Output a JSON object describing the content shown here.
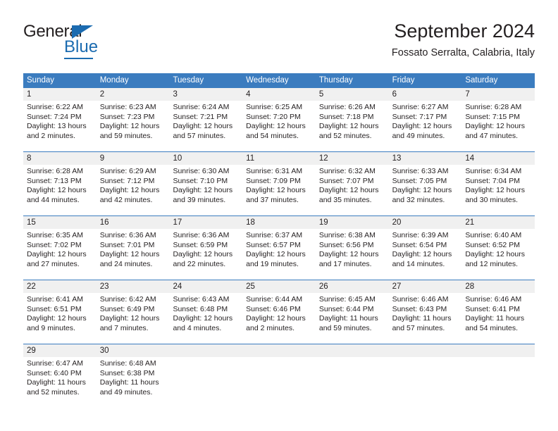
{
  "brand": {
    "name_part1": "General",
    "name_part2": "Blue",
    "logo_icon": "triangle-flag-icon",
    "accent_color": "#1b6bb0"
  },
  "header": {
    "month_title": "September 2024",
    "location": "Fossato Serralta, Calabria, Italy",
    "header_bg_color": "#3b7cbf",
    "daynumber_bg_color": "#f0f0f0"
  },
  "weekdays": [
    "Sunday",
    "Monday",
    "Tuesday",
    "Wednesday",
    "Thursday",
    "Friday",
    "Saturday"
  ],
  "labels": {
    "sunrise_prefix": "Sunrise:",
    "sunset_prefix": "Sunset:",
    "daylight_prefix": "Daylight:"
  },
  "weeks": [
    {
      "days": [
        {
          "num": "1",
          "sunrise": "Sunrise: 6:22 AM",
          "sunset": "Sunset: 7:24 PM",
          "daylight_1": "Daylight: 13 hours",
          "daylight_2": "and 2 minutes."
        },
        {
          "num": "2",
          "sunrise": "Sunrise: 6:23 AM",
          "sunset": "Sunset: 7:23 PM",
          "daylight_1": "Daylight: 12 hours",
          "daylight_2": "and 59 minutes."
        },
        {
          "num": "3",
          "sunrise": "Sunrise: 6:24 AM",
          "sunset": "Sunset: 7:21 PM",
          "daylight_1": "Daylight: 12 hours",
          "daylight_2": "and 57 minutes."
        },
        {
          "num": "4",
          "sunrise": "Sunrise: 6:25 AM",
          "sunset": "Sunset: 7:20 PM",
          "daylight_1": "Daylight: 12 hours",
          "daylight_2": "and 54 minutes."
        },
        {
          "num": "5",
          "sunrise": "Sunrise: 6:26 AM",
          "sunset": "Sunset: 7:18 PM",
          "daylight_1": "Daylight: 12 hours",
          "daylight_2": "and 52 minutes."
        },
        {
          "num": "6",
          "sunrise": "Sunrise: 6:27 AM",
          "sunset": "Sunset: 7:17 PM",
          "daylight_1": "Daylight: 12 hours",
          "daylight_2": "and 49 minutes."
        },
        {
          "num": "7",
          "sunrise": "Sunrise: 6:28 AM",
          "sunset": "Sunset: 7:15 PM",
          "daylight_1": "Daylight: 12 hours",
          "daylight_2": "and 47 minutes."
        }
      ]
    },
    {
      "days": [
        {
          "num": "8",
          "sunrise": "Sunrise: 6:28 AM",
          "sunset": "Sunset: 7:13 PM",
          "daylight_1": "Daylight: 12 hours",
          "daylight_2": "and 44 minutes."
        },
        {
          "num": "9",
          "sunrise": "Sunrise: 6:29 AM",
          "sunset": "Sunset: 7:12 PM",
          "daylight_1": "Daylight: 12 hours",
          "daylight_2": "and 42 minutes."
        },
        {
          "num": "10",
          "sunrise": "Sunrise: 6:30 AM",
          "sunset": "Sunset: 7:10 PM",
          "daylight_1": "Daylight: 12 hours",
          "daylight_2": "and 39 minutes."
        },
        {
          "num": "11",
          "sunrise": "Sunrise: 6:31 AM",
          "sunset": "Sunset: 7:09 PM",
          "daylight_1": "Daylight: 12 hours",
          "daylight_2": "and 37 minutes."
        },
        {
          "num": "12",
          "sunrise": "Sunrise: 6:32 AM",
          "sunset": "Sunset: 7:07 PM",
          "daylight_1": "Daylight: 12 hours",
          "daylight_2": "and 35 minutes."
        },
        {
          "num": "13",
          "sunrise": "Sunrise: 6:33 AM",
          "sunset": "Sunset: 7:05 PM",
          "daylight_1": "Daylight: 12 hours",
          "daylight_2": "and 32 minutes."
        },
        {
          "num": "14",
          "sunrise": "Sunrise: 6:34 AM",
          "sunset": "Sunset: 7:04 PM",
          "daylight_1": "Daylight: 12 hours",
          "daylight_2": "and 30 minutes."
        }
      ]
    },
    {
      "days": [
        {
          "num": "15",
          "sunrise": "Sunrise: 6:35 AM",
          "sunset": "Sunset: 7:02 PM",
          "daylight_1": "Daylight: 12 hours",
          "daylight_2": "and 27 minutes."
        },
        {
          "num": "16",
          "sunrise": "Sunrise: 6:36 AM",
          "sunset": "Sunset: 7:01 PM",
          "daylight_1": "Daylight: 12 hours",
          "daylight_2": "and 24 minutes."
        },
        {
          "num": "17",
          "sunrise": "Sunrise: 6:36 AM",
          "sunset": "Sunset: 6:59 PM",
          "daylight_1": "Daylight: 12 hours",
          "daylight_2": "and 22 minutes."
        },
        {
          "num": "18",
          "sunrise": "Sunrise: 6:37 AM",
          "sunset": "Sunset: 6:57 PM",
          "daylight_1": "Daylight: 12 hours",
          "daylight_2": "and 19 minutes."
        },
        {
          "num": "19",
          "sunrise": "Sunrise: 6:38 AM",
          "sunset": "Sunset: 6:56 PM",
          "daylight_1": "Daylight: 12 hours",
          "daylight_2": "and 17 minutes."
        },
        {
          "num": "20",
          "sunrise": "Sunrise: 6:39 AM",
          "sunset": "Sunset: 6:54 PM",
          "daylight_1": "Daylight: 12 hours",
          "daylight_2": "and 14 minutes."
        },
        {
          "num": "21",
          "sunrise": "Sunrise: 6:40 AM",
          "sunset": "Sunset: 6:52 PM",
          "daylight_1": "Daylight: 12 hours",
          "daylight_2": "and 12 minutes."
        }
      ]
    },
    {
      "days": [
        {
          "num": "22",
          "sunrise": "Sunrise: 6:41 AM",
          "sunset": "Sunset: 6:51 PM",
          "daylight_1": "Daylight: 12 hours",
          "daylight_2": "and 9 minutes."
        },
        {
          "num": "23",
          "sunrise": "Sunrise: 6:42 AM",
          "sunset": "Sunset: 6:49 PM",
          "daylight_1": "Daylight: 12 hours",
          "daylight_2": "and 7 minutes."
        },
        {
          "num": "24",
          "sunrise": "Sunrise: 6:43 AM",
          "sunset": "Sunset: 6:48 PM",
          "daylight_1": "Daylight: 12 hours",
          "daylight_2": "and 4 minutes."
        },
        {
          "num": "25",
          "sunrise": "Sunrise: 6:44 AM",
          "sunset": "Sunset: 6:46 PM",
          "daylight_1": "Daylight: 12 hours",
          "daylight_2": "and 2 minutes."
        },
        {
          "num": "26",
          "sunrise": "Sunrise: 6:45 AM",
          "sunset": "Sunset: 6:44 PM",
          "daylight_1": "Daylight: 11 hours",
          "daylight_2": "and 59 minutes."
        },
        {
          "num": "27",
          "sunrise": "Sunrise: 6:46 AM",
          "sunset": "Sunset: 6:43 PM",
          "daylight_1": "Daylight: 11 hours",
          "daylight_2": "and 57 minutes."
        },
        {
          "num": "28",
          "sunrise": "Sunrise: 6:46 AM",
          "sunset": "Sunset: 6:41 PM",
          "daylight_1": "Daylight: 11 hours",
          "daylight_2": "and 54 minutes."
        }
      ]
    },
    {
      "days": [
        {
          "num": "29",
          "sunrise": "Sunrise: 6:47 AM",
          "sunset": "Sunset: 6:40 PM",
          "daylight_1": "Daylight: 11 hours",
          "daylight_2": "and 52 minutes."
        },
        {
          "num": "30",
          "sunrise": "Sunrise: 6:48 AM",
          "sunset": "Sunset: 6:38 PM",
          "daylight_1": "Daylight: 11 hours",
          "daylight_2": "and 49 minutes."
        },
        {
          "num": "",
          "sunrise": "",
          "sunset": "",
          "daylight_1": "",
          "daylight_2": ""
        },
        {
          "num": "",
          "sunrise": "",
          "sunset": "",
          "daylight_1": "",
          "daylight_2": ""
        },
        {
          "num": "",
          "sunrise": "",
          "sunset": "",
          "daylight_1": "",
          "daylight_2": ""
        },
        {
          "num": "",
          "sunrise": "",
          "sunset": "",
          "daylight_1": "",
          "daylight_2": ""
        },
        {
          "num": "",
          "sunrise": "",
          "sunset": "",
          "daylight_1": "",
          "daylight_2": ""
        }
      ]
    }
  ]
}
